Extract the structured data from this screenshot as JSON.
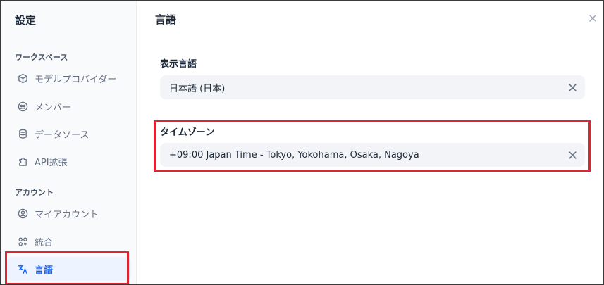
{
  "sidebar": {
    "title": "設定",
    "sections": [
      {
        "label": "ワークスペース",
        "items": [
          {
            "label": "モデルプロバイダー",
            "icon": "cube-icon"
          },
          {
            "label": "メンバー",
            "icon": "members-icon"
          },
          {
            "label": "データソース",
            "icon": "database-icon"
          },
          {
            "label": "API拡張",
            "icon": "puzzle-icon"
          }
        ]
      },
      {
        "label": "アカウント",
        "items": [
          {
            "label": "マイアカウント",
            "icon": "user-circle-icon"
          },
          {
            "label": "統合",
            "icon": "integrations-icon"
          },
          {
            "label": "言語",
            "icon": "translate-icon",
            "active": true
          }
        ]
      }
    ]
  },
  "main": {
    "title": "言語",
    "display_language": {
      "label": "表示言語",
      "value": "日本語 (日本)"
    },
    "timezone": {
      "label": "タイムゾーン",
      "value": "+09:00 Japan Time - Tokyo, Yokohama, Osaka, Nagoya"
    }
  },
  "colors": {
    "accent": "#155eef",
    "highlight": "#e0232e",
    "active_bg": "#eef4ff",
    "select_bg": "#f2f4f7"
  }
}
